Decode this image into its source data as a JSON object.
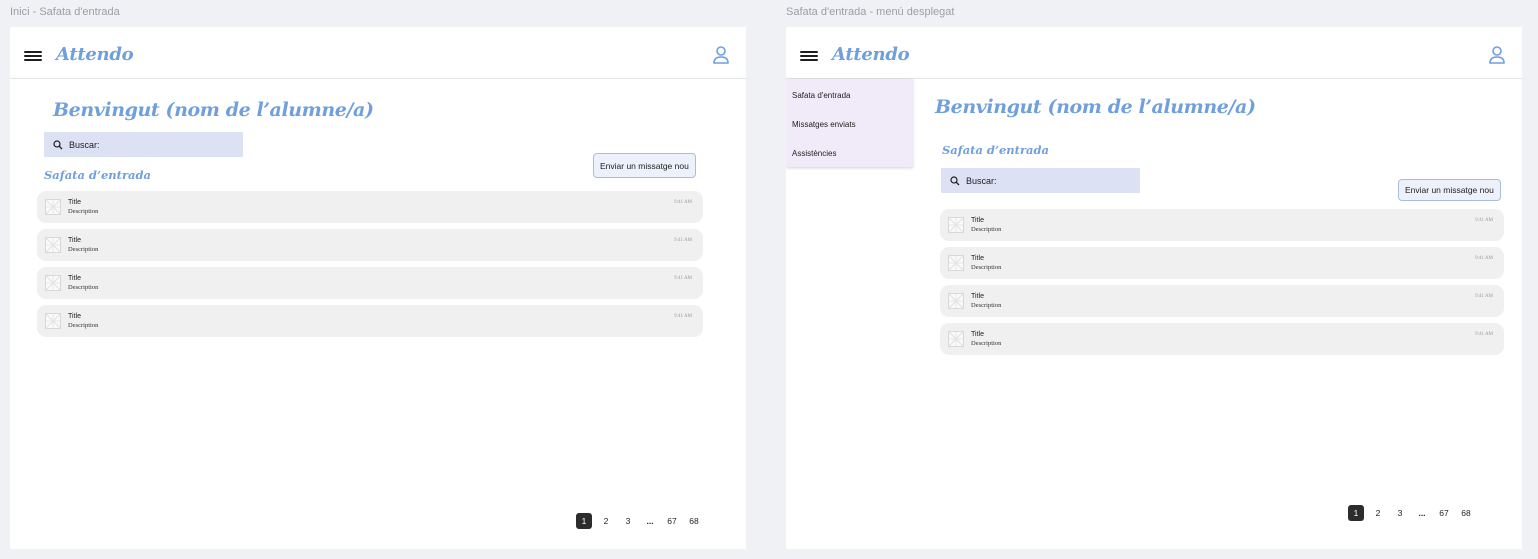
{
  "frames": [
    {
      "label": "Inici - Safata d'entrada",
      "brand": "Attendo",
      "welcome": "Benvingut (nom de l’alumne/a)",
      "search_label": "Buscar:",
      "section_title": "Safata d’entrada",
      "send_button": "Enviar un missatge nou",
      "items": [
        {
          "title": "Title",
          "description": "Description",
          "time": "9:41 AM"
        },
        {
          "title": "Title",
          "description": "Description",
          "time": "9:41 AM"
        },
        {
          "title": "Title",
          "description": "Description",
          "time": "9:41 AM"
        },
        {
          "title": "Title",
          "description": "Description",
          "time": "9:41 AM"
        }
      ],
      "pagination": [
        "1",
        "2",
        "3",
        "...",
        "67",
        "68"
      ],
      "current_page": "1"
    },
    {
      "label": "Safata d'entrada - menú desplegat",
      "brand": "Attendo",
      "menu": [
        "Safata d'entrada",
        "Missatges enviats",
        "Assistències"
      ],
      "welcome": "Benvingut (nom de l’alumne/a)",
      "section_title": "Safata d’entrada",
      "search_label": "Buscar:",
      "send_button": "Enviar un missatge nou",
      "items": [
        {
          "title": "Title",
          "description": "Description",
          "time": "9:41 AM"
        },
        {
          "title": "Title",
          "description": "Description",
          "time": "9:41 AM"
        },
        {
          "title": "Title",
          "description": "Description",
          "time": "9:41 AM"
        },
        {
          "title": "Title",
          "description": "Description",
          "time": "9:41 AM"
        }
      ],
      "pagination": [
        "1",
        "2",
        "3",
        "...",
        "67",
        "68"
      ],
      "current_page": "1"
    }
  ],
  "colors": {
    "accent": "#6f9fdc",
    "search_bg": "#dce1f4",
    "menu_bg": "#f1eaf8",
    "row_bg": "#f0f0f0"
  },
  "icons": [
    "hamburger-icon",
    "user-icon",
    "search-icon",
    "image-placeholder-icon"
  ]
}
